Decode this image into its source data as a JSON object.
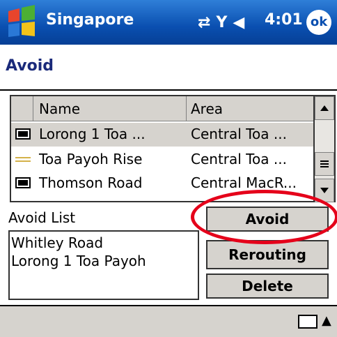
{
  "title_bar": {
    "app_title": "Singapore",
    "time": "4:01",
    "ok_label": "ok",
    "icons": [
      "windows-logo-icon",
      "sync-icon",
      "signal-icon",
      "speaker-icon"
    ]
  },
  "header": {
    "title": "Avoid"
  },
  "listview": {
    "columns": [
      "Name",
      "Area"
    ],
    "rows": [
      {
        "icon": "road-sign-icon",
        "name": "Lorong 1 Toa ...",
        "area": "Central Toa ...",
        "selected": true
      },
      {
        "icon": "road-line-icon",
        "name": "Toa Payoh Rise",
        "area": "Central Toa ...",
        "selected": false
      },
      {
        "icon": "road-sign-icon",
        "name": "Thomson Road",
        "area": "Central MacR...",
        "selected": false
      }
    ]
  },
  "avoid_list": {
    "label": "Avoid List",
    "items": [
      "Whitley Road",
      "Lorong 1 Toa Payoh"
    ]
  },
  "buttons": {
    "avoid": "Avoid",
    "rerouting": "Rerouting",
    "delete": "Delete"
  },
  "colors": {
    "titlebar": "#0a4fb0",
    "annotation": "#e5001a",
    "panel": "#d6d3ce"
  }
}
